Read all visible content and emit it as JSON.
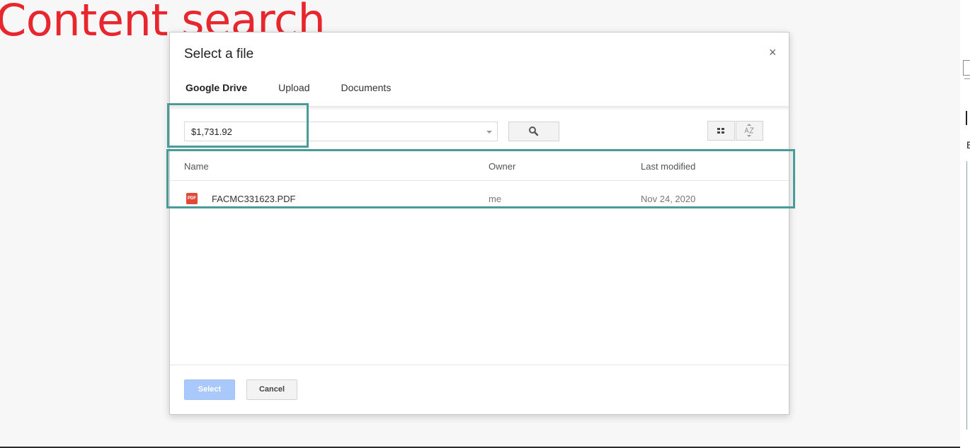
{
  "headline": "Content search",
  "dialog": {
    "title": "Select a file",
    "close_label": "×",
    "tabs": [
      {
        "label": "Google Drive",
        "active": true
      },
      {
        "label": "Upload",
        "active": false
      },
      {
        "label": "Documents",
        "active": false
      }
    ],
    "search": {
      "value": "$1,731.92"
    },
    "columns": {
      "name": "Name",
      "owner": "Owner",
      "modified": "Last modified"
    },
    "files": [
      {
        "icon": "pdf-icon",
        "icon_text": "PDF",
        "name": "FACMC331623.PDF",
        "owner": "me",
        "modified": "Nov 24, 2020"
      }
    ],
    "buttons": {
      "select": "Select",
      "cancel": "Cancel"
    }
  },
  "edge": {
    "char": "E"
  },
  "colors": {
    "headline": "#e8262d",
    "highlight": "#4a9b97",
    "primary_disabled": "#a9c8fb",
    "pdf": "#e04a3a"
  }
}
